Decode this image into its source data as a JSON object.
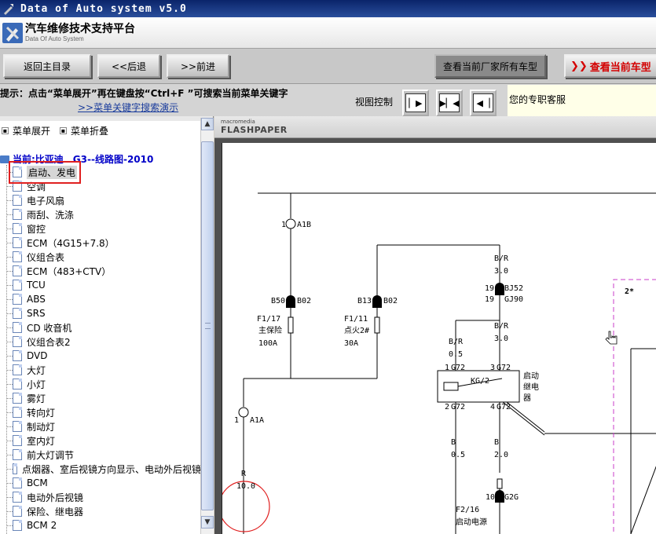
{
  "window": {
    "title": "Data of Auto system v5.0"
  },
  "header": {
    "title": "汽车维修技术支持平台",
    "subtitle": "Data Of Auto System"
  },
  "toolbar": {
    "home": "返回主目录",
    "back": "<<后退",
    "forward": ">>前进",
    "all_models": "查看当前厂家所有车型",
    "current_model": "查看当前车型"
  },
  "hint": {
    "text": "提示：点击“菜单展开”再在键盘按“Ctrl+F ”可搜索当前菜单关键字",
    "link": ">>菜单关键字搜索演示",
    "view_label": "视图控制",
    "service": "您的专职客服"
  },
  "tree": {
    "expand": "菜单展开",
    "collapse": "菜单折叠",
    "root": "当前:比亚迪　G3--线路图-2010",
    "items": [
      "启动、发电",
      "空调",
      "电子风扇",
      "雨刮、洗涤",
      "窗控",
      "ECM（4G15+7.8）",
      "仪组合表",
      "ECM（483+CTV）",
      "TCU",
      "ABS",
      "SRS",
      "CD 收音机",
      "仪组合表2",
      "DVD",
      "大灯",
      "小灯",
      "雾灯",
      "转向灯",
      "制动灯",
      "室内灯",
      "前大灯调节",
      "点烟器、室后视镜方向显示、电动外后视镜",
      "BCM",
      "电动外后视镜",
      "保险、继电器",
      "BCM 2"
    ]
  },
  "viewer": {
    "brand_small": "macromedia",
    "brand": "FLASHPAPER"
  },
  "schematic": {
    "labels": {
      "a1b": "1",
      "a1b_name": "A1B",
      "b50": "B50",
      "b02a": "B02",
      "f117": "F1/17",
      "f117_name": "主保险",
      "f117_amp": "100A",
      "b13": "B13",
      "b02b": "B02",
      "f111": "F1/11",
      "f111_name": "点火2#",
      "f111_amp": "30A",
      "br1": "B/R",
      "br1_val": "3.0",
      "bj52_pin": "19",
      "bj52": "BJ52",
      "gj90_pin": "19",
      "gj90": "GJ90",
      "br2": "B/R",
      "br2_val": "3.0",
      "br3": "B/R",
      "br3_val": "0.5",
      "g72_1": "1",
      "g72_a": "G72",
      "g72_3": "3",
      "g72_b": "G72",
      "kg2": "KG/2",
      "relay_name": "启动继电器",
      "g72_2": "2",
      "g72_c": "G72",
      "g72_4": "4",
      "g72_d": "G72",
      "b_a": "B",
      "b_a_val": "0.5",
      "b_b": "B",
      "b_b_val": "2.0",
      "a1a_pin": "1",
      "a1a": "A1A",
      "r": "R",
      "r_val": "10.0",
      "g2g_pin": "10",
      "g2g": "G2G",
      "f216": "F2/16",
      "f216_name": "启动电源",
      "box_label": "2*"
    }
  }
}
